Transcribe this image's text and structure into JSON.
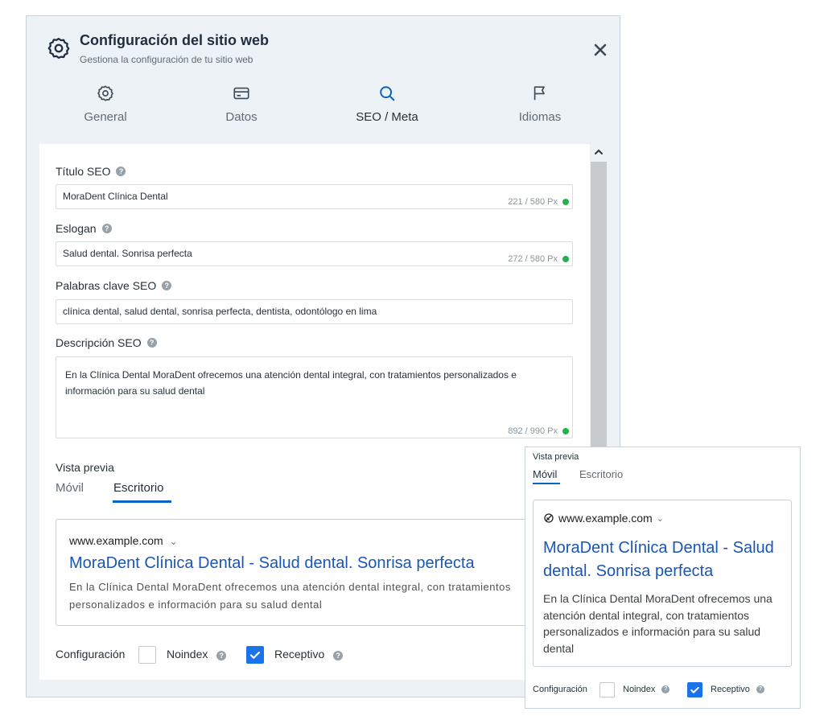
{
  "header": {
    "title": "Configuración del sitio web",
    "subtitle": "Gestiona la configuración de tu sitio web",
    "icon": "gear-icon",
    "close_icon": "close-icon"
  },
  "tabs": [
    {
      "label": "General",
      "icon": "gear-icon",
      "active": false
    },
    {
      "label": "Datos",
      "icon": "card-icon",
      "active": false
    },
    {
      "label": "SEO / Meta",
      "icon": "search-icon",
      "active": true
    },
    {
      "label": "Idiomas",
      "icon": "flag-icon",
      "active": false
    }
  ],
  "form": {
    "title": {
      "label": "Título SEO",
      "value": "MoraDent Clínica Dental",
      "counter": "221 / 580 Px"
    },
    "slogan": {
      "label": "Eslogan",
      "value": "Salud dental. Sonrisa perfecta",
      "counter": "272 / 580 Px"
    },
    "keywords": {
      "label": "Palabras clave SEO",
      "value": "clínica dental, salud dental, sonrisa perfecta, dentista, odontólogo en lima"
    },
    "description": {
      "label": "Descripción SEO",
      "value": "En la Clínica Dental MoraDent ofrecemos una atención dental integral, con tratamientos personalizados e información para su salud dental",
      "counter": "892 / 990 Px"
    }
  },
  "preview": {
    "label": "Vista previa",
    "tabs": [
      {
        "label": "Móvil",
        "active": false
      },
      {
        "label": "Escritorio",
        "active": true
      }
    ],
    "url": "www.example.com",
    "url_caret": "⌄",
    "title": "MoraDent Clínica Dental - Salud dental. Sonrisa perfecta",
    "description": "En la Clínica Dental MoraDent ofrecemos una atención dental integral, con tratamientos personalizados e información para su salud dental"
  },
  "config": {
    "label": "Configuración",
    "noindex": {
      "label": "Noindex",
      "checked": false
    },
    "receptivo": {
      "label": "Receptivo",
      "checked": true
    }
  },
  "mobile_preview": {
    "label": "Vista previa",
    "tabs": [
      {
        "label": "Móvil",
        "active": true
      },
      {
        "label": "Escritorio",
        "active": false
      }
    ],
    "url": "www.example.com",
    "url_caret": "⌄",
    "title": "MoraDent Clínica Dental - Salud dental. Sonrisa perfecta",
    "description": "En la Clínica Dental MoraDent ofrecemos una atención dental integral, con tratamientos personalizados e información para su salud dental",
    "config": {
      "label": "Configuración",
      "noindex": {
        "label": "Noindex",
        "checked": false
      },
      "receptivo": {
        "label": "Receptivo",
        "checked": true
      }
    }
  },
  "colors": {
    "accent": "#0b63c6",
    "link": "#1a56b6",
    "checkbox": "#1a73e8",
    "ok_dot": "#22b14c"
  }
}
